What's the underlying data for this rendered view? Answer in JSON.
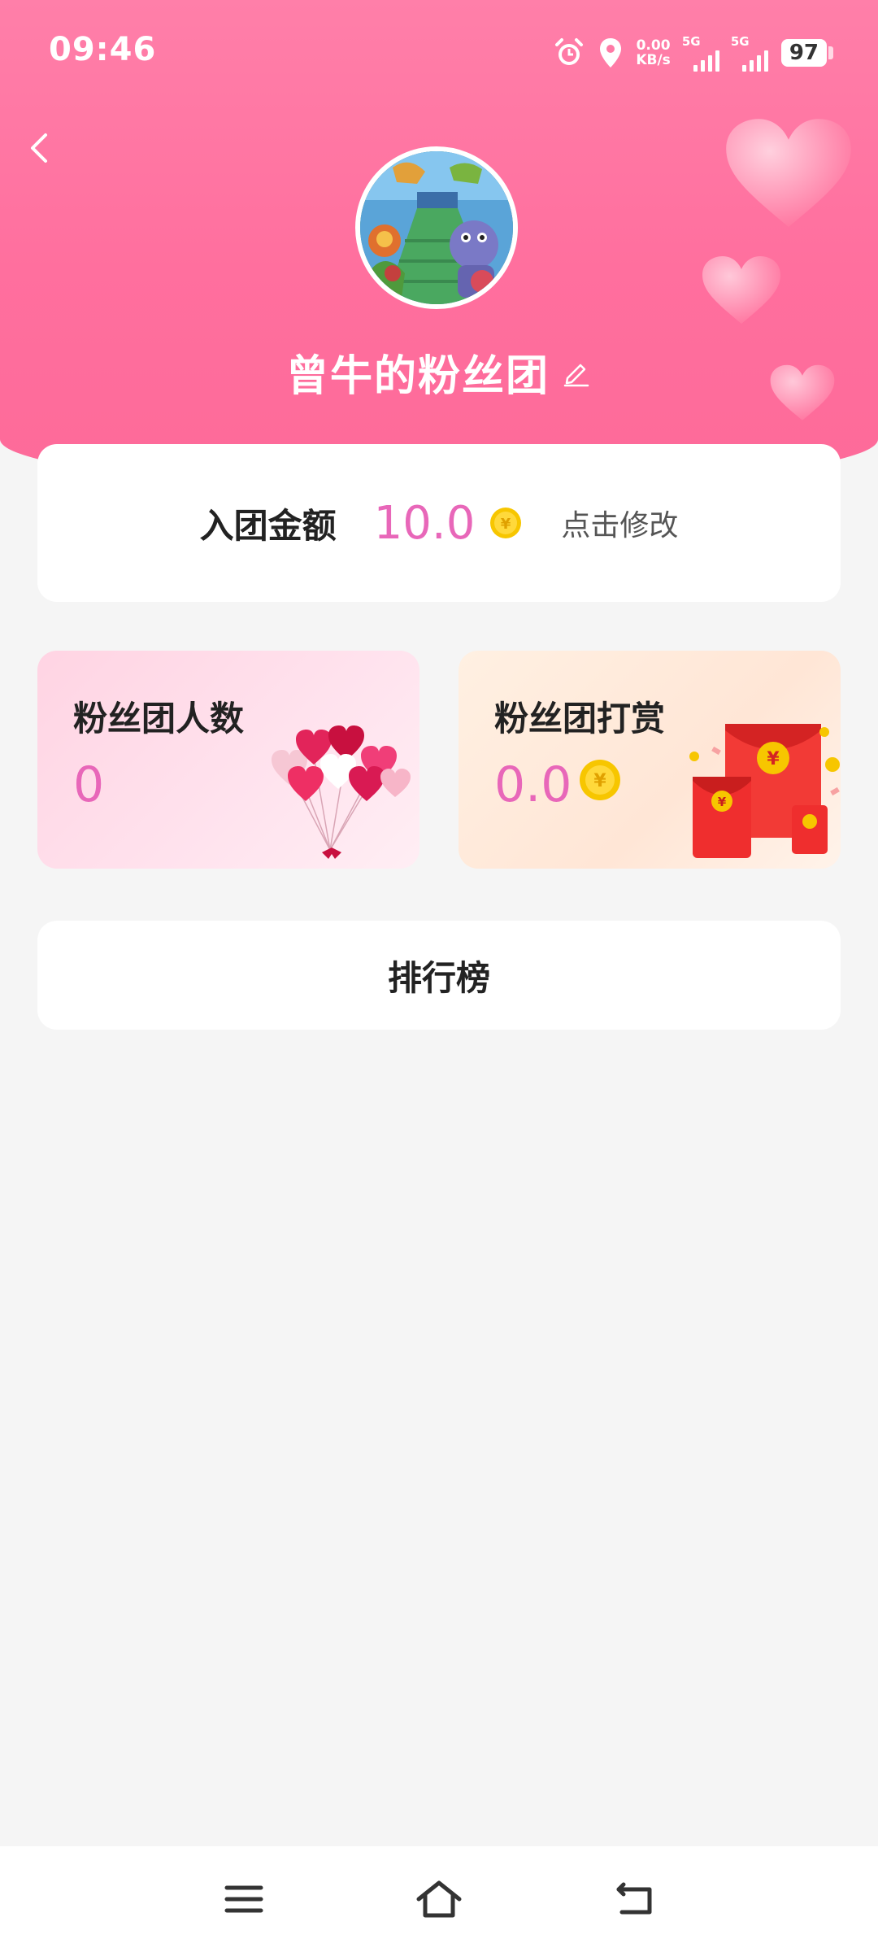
{
  "status_bar": {
    "time": "09:46",
    "net_speed_value": "0.00",
    "net_speed_unit": "KB/s",
    "signal1_label": "5G",
    "signal2_label": "5G",
    "battery": "97",
    "icons": [
      "alarm-icon",
      "location-icon"
    ]
  },
  "header": {
    "title": "曾牛的粉丝团",
    "avatar": "game-avatar"
  },
  "fee_card": {
    "label": "入团金额",
    "value": "10.0",
    "edit_label": "点击修改"
  },
  "members_card": {
    "label": "粉丝团人数",
    "value": "0"
  },
  "reward_card": {
    "label": "粉丝团打赏",
    "value": "0.0"
  },
  "ranking": {
    "label": "排行榜"
  },
  "colors": {
    "header_pink": "#ff6f9e",
    "accent_value": "#e867b9",
    "coin_gold": "#f7c600",
    "background": "#f5f5f5"
  }
}
